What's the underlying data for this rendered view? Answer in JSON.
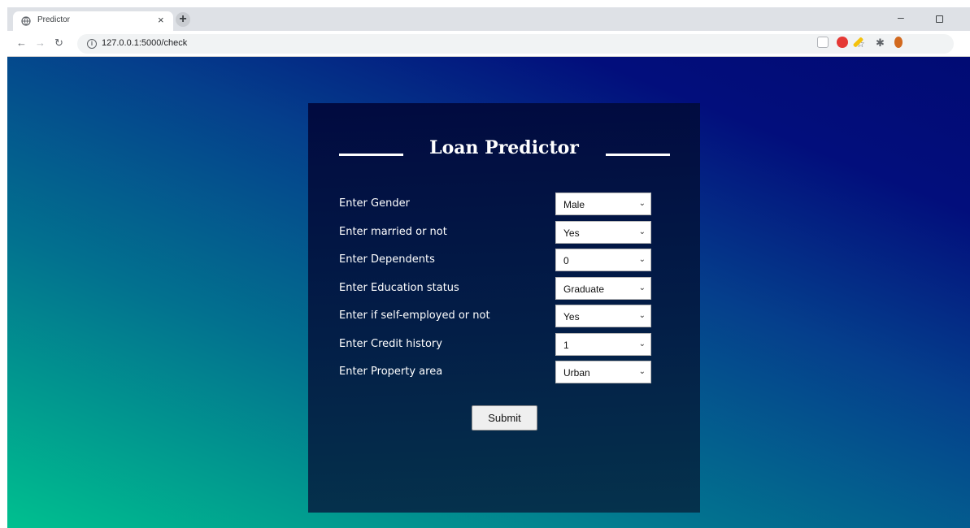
{
  "browser": {
    "tab_title": "Predictor",
    "tab_close": "×",
    "new_tab": "+",
    "url": "127.0.0.1:5000/check",
    "minimize": "–",
    "icons": [
      "globe-icon",
      "back-icon",
      "forward-icon",
      "reload-icon",
      "info-icon",
      "key-icon",
      "zoom-icon",
      "star-icon",
      "extension-icon",
      "adblock-icon",
      "puzzle-icon",
      "profile-icon"
    ]
  },
  "page": {
    "title": "Loan Predictor",
    "fields": [
      {
        "label": "Enter Gender",
        "value": "Male"
      },
      {
        "label": "Enter married or not",
        "value": "Yes"
      },
      {
        "label": "Enter Dependents",
        "value": "0"
      },
      {
        "label": "Enter Education status",
        "value": "Graduate"
      },
      {
        "label": "Enter if self-employed or not",
        "value": "Yes"
      },
      {
        "label": "Enter Credit history",
        "value": "1"
      },
      {
        "label": "Enter Property area",
        "value": "Urban"
      }
    ],
    "submit_label": "Submit"
  },
  "colors": {
    "tabstrip": "#dee1e6",
    "card": "#031e47",
    "gradient_teal": "#00c08f",
    "gradient_navy": "#010b74"
  }
}
